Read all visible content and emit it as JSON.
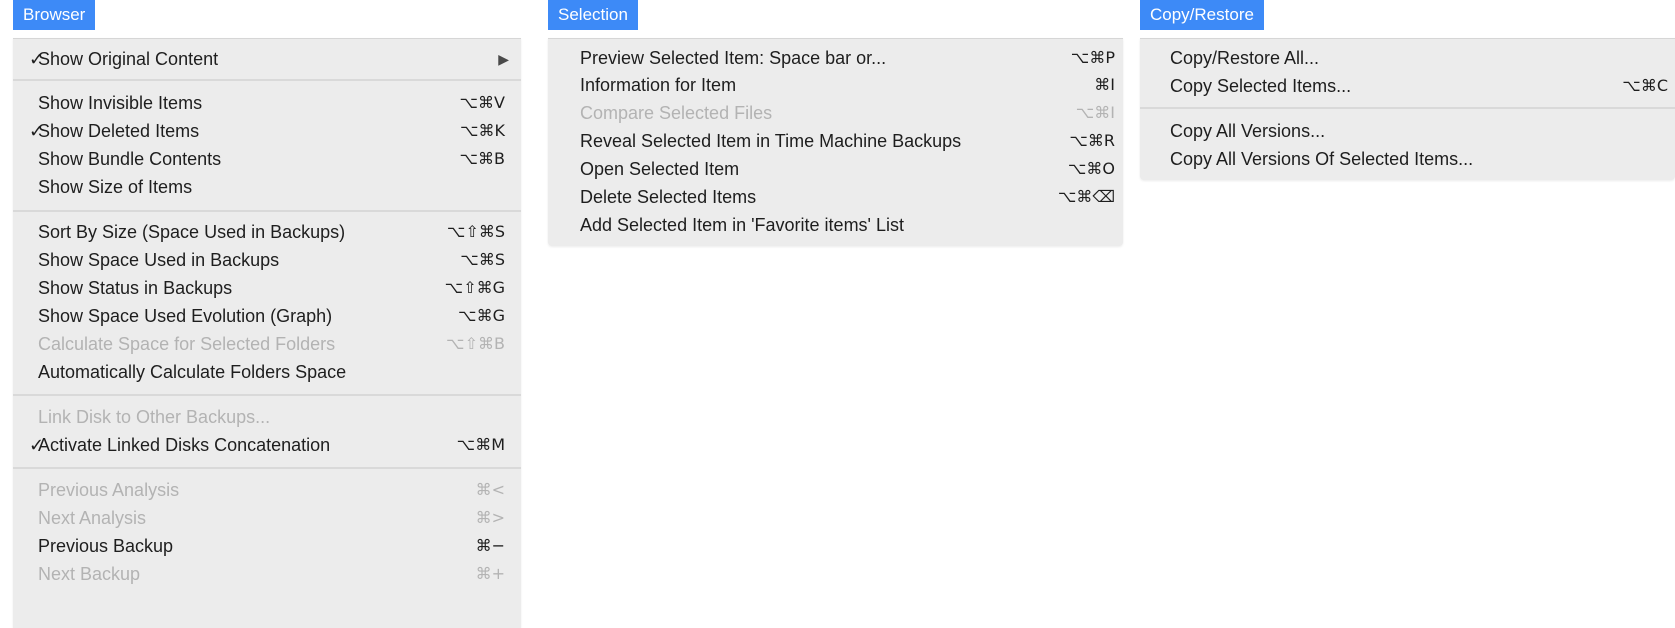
{
  "colors": {
    "accent": "#3d8af7",
    "menu_bg": "#ececec",
    "disabled_text": "#b3b3b3"
  },
  "browser": {
    "title": "Browser",
    "items": [
      {
        "check": "✓",
        "label": "Show Original Content",
        "submenu": "▶",
        "disabled": false
      },
      {
        "check": "",
        "label": "Show Invisible Items",
        "shortcut": "⌥⌘V",
        "disabled": false
      },
      {
        "check": "✓",
        "label": "Show Deleted Items",
        "shortcut": "⌥⌘K",
        "disabled": false
      },
      {
        "check": "",
        "label": "Show Bundle Contents",
        "shortcut": "⌥⌘B",
        "disabled": false
      },
      {
        "check": "",
        "label": "Show Size of Items",
        "shortcut": "",
        "disabled": false
      },
      {
        "check": "",
        "label": "Sort By Size (Space Used in Backups)",
        "shortcut": "⌥⇧⌘S",
        "disabled": false
      },
      {
        "check": "",
        "label": "Show Space Used in Backups",
        "shortcut": "⌥⌘S",
        "disabled": false
      },
      {
        "check": "",
        "label": "Show Status in Backups",
        "shortcut": "⌥⇧⌘G",
        "disabled": false
      },
      {
        "check": "",
        "label": "Show Space Used Evolution (Graph)",
        "shortcut": "⌥⌘G",
        "disabled": false
      },
      {
        "check": "",
        "label": "Calculate Space for Selected Folders",
        "shortcut": "⌥⇧⌘B",
        "disabled": true
      },
      {
        "check": "",
        "label": "Automatically Calculate Folders Space",
        "shortcut": "",
        "disabled": false
      },
      {
        "check": "",
        "label": "Link Disk to Other Backups...",
        "shortcut": "",
        "disabled": true
      },
      {
        "check": "✓",
        "label": "Activate Linked Disks Concatenation",
        "shortcut": "⌥⌘M",
        "disabled": false
      },
      {
        "check": "",
        "label": "Previous Analysis",
        "shortcut": "⌘<",
        "disabled": true
      },
      {
        "check": "",
        "label": "Next Analysis",
        "shortcut": "⌘>",
        "disabled": true
      },
      {
        "check": "",
        "label": "Previous Backup",
        "shortcut": "⌘−",
        "disabled": false
      },
      {
        "check": "",
        "label": "Next Backup",
        "shortcut": "⌘+",
        "disabled": true
      }
    ]
  },
  "selection": {
    "title": "Selection",
    "items": [
      {
        "label": "Preview Selected Item: Space bar or...",
        "shortcut": "⌥⌘P",
        "disabled": false
      },
      {
        "label": "Information for Item",
        "shortcut": "⌘I",
        "disabled": false
      },
      {
        "label": "Compare Selected Files",
        "shortcut": "⌥⌘I",
        "disabled": true
      },
      {
        "label": "Reveal Selected Item in Time Machine Backups",
        "shortcut": "⌥⌘R",
        "disabled": false
      },
      {
        "label": "Open Selected Item",
        "shortcut": "⌥⌘O",
        "disabled": false
      },
      {
        "label": "Delete Selected Items",
        "shortcut": "⌥⌘⌫",
        "disabled": false
      },
      {
        "label": "Add Selected Item in 'Favorite items' List",
        "shortcut": "",
        "disabled": false
      }
    ]
  },
  "copy_restore": {
    "title": "Copy/Restore",
    "items": [
      {
        "label": "Copy/Restore All...",
        "shortcut": "",
        "disabled": false
      },
      {
        "label": "Copy Selected Items...",
        "shortcut": "⌥⌘C",
        "disabled": false
      },
      {
        "label": "Copy All Versions...",
        "shortcut": "",
        "disabled": false
      },
      {
        "label": "Copy All Versions Of Selected Items...",
        "shortcut": "",
        "disabled": false
      }
    ]
  }
}
